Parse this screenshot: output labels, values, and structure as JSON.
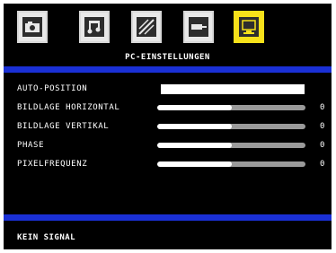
{
  "icons": [
    {
      "name": "picture-icon",
      "active": false
    },
    {
      "name": "sound-icon",
      "active": false
    },
    {
      "name": "screen-adjust-icon",
      "active": false
    },
    {
      "name": "input-icon",
      "active": false
    },
    {
      "name": "pc-monitor-icon",
      "active": true
    }
  ],
  "header": {
    "title": "PC-EINSTELLUNGEN"
  },
  "menu": {
    "auto_position": {
      "label": "AUTO-POSITION"
    },
    "items": [
      {
        "label": "BILDLAGE HORIZONTAL",
        "value": "0",
        "level": 0.5
      },
      {
        "label": "BILDLAGE VERTIKAL",
        "value": "0",
        "level": 0.5
      },
      {
        "label": "PHASE",
        "value": "0",
        "level": 0.5
      },
      {
        "label": "PIXELFREQUENZ",
        "value": "0",
        "level": 0.5
      }
    ]
  },
  "status": {
    "text": "KEIN SIGNAL"
  },
  "colors": {
    "osd_background": "#000000",
    "accent_blue": "#1a30d6",
    "active_icon": "#f7e11a"
  }
}
